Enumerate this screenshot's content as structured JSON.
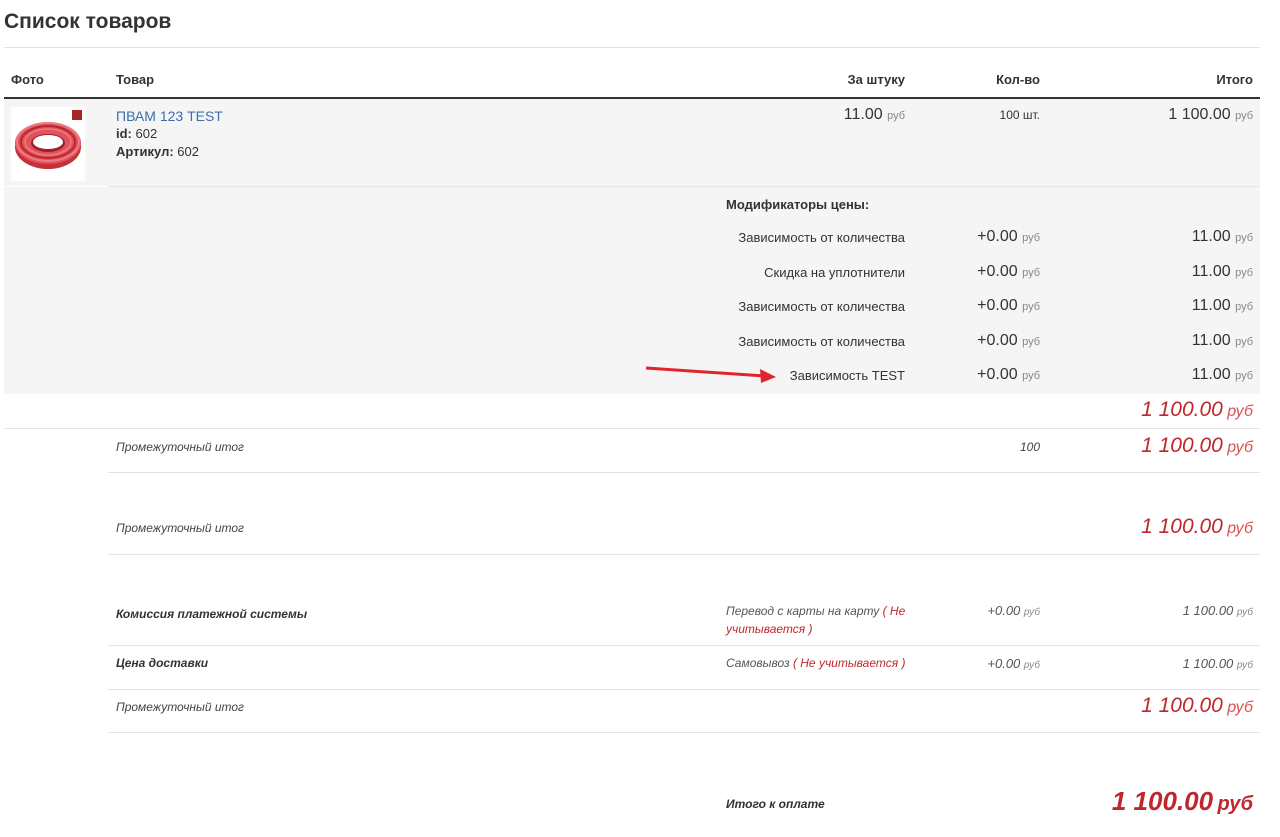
{
  "page_title": "Список товаров",
  "headers": {
    "photo": "Фото",
    "product": "Товар",
    "per_unit": "За штуку",
    "qty": "Кол-во",
    "total": "Итого"
  },
  "item": {
    "name": "ПВАМ 123 TEST",
    "id_label": "id:",
    "id_value": "602",
    "sku_label": "Артикул:",
    "sku_value": "602",
    "price": "11.00",
    "currency": "руб",
    "qty": "100 шт.",
    "total": "1 100.00",
    "image_color": "#d9434f"
  },
  "modifiers": {
    "title": "Модификаторы цены:",
    "rows": [
      {
        "name": "Зависимость от количества",
        "delta": "+0.00",
        "total": "11.00"
      },
      {
        "name": "Скидка на уплотнители",
        "delta": "+0.00",
        "total": "11.00"
      },
      {
        "name": "Зависимость от количества",
        "delta": "+0.00",
        "total": "11.00"
      },
      {
        "name": "Зависимость от количества",
        "delta": "+0.00",
        "total": "11.00"
      },
      {
        "name": "Зависимость TEST",
        "delta": "+0.00",
        "total": "11.00"
      }
    ]
  },
  "item_sum": "1 100.00",
  "subtotal1": {
    "label": "Промежуточный итог",
    "qty": "100",
    "amount": "1 100.00"
  },
  "subtotal2": {
    "label": "Промежуточный итог",
    "amount": "1 100.00"
  },
  "commission": {
    "label": "Комиссия платежной системы",
    "method": "Перевод с карты на карту",
    "method_note": "( Не учитывается )",
    "delta": "+0.00",
    "amount": "1 100.00"
  },
  "delivery": {
    "label": "Цена доставки",
    "method": "Самовывоз",
    "method_note": "( Не учитывается )",
    "delta": "+0.00",
    "amount": "1 100.00"
  },
  "subtotal3": {
    "label": "Промежуточный итог",
    "amount": "1 100.00"
  },
  "grand_total": {
    "label": "Итого к оплате",
    "amount": "1 100.00"
  },
  "colors": {
    "accent_red": "#c0272d",
    "link_blue": "#3c6ea8",
    "row_grey": "#f5f5f5"
  }
}
